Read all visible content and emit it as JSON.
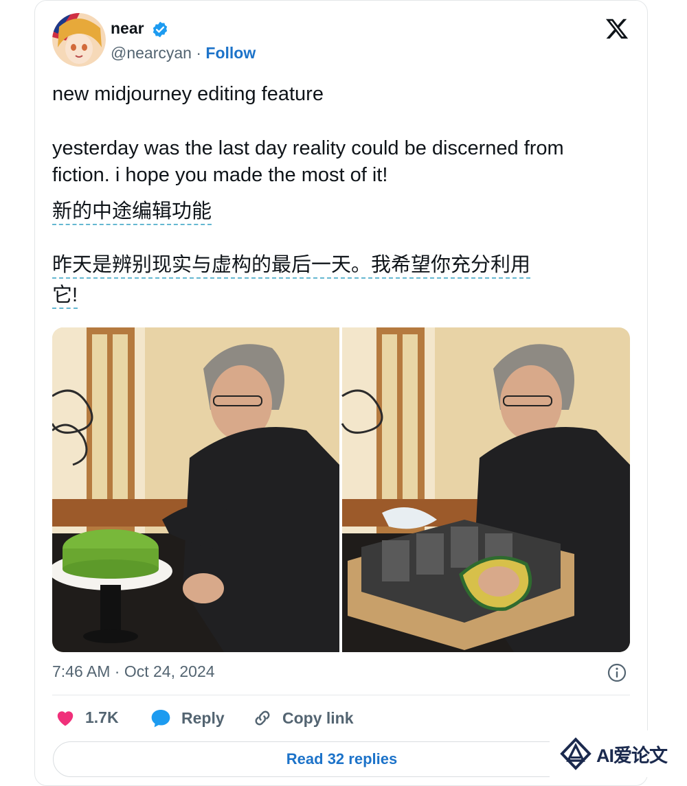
{
  "tweet": {
    "name": "near",
    "handle": "@nearcyan",
    "separator": "·",
    "follow_label": "Follow",
    "text_line1": "new midjourney editing feature",
    "text_line2": "yesterday was the last day reality could be discerned from",
    "text_line3": "fiction. i hope you made the most of it!",
    "translation_line1": "新的中途编辑功能",
    "translation_line2": "昨天是辨别现实与虚构的最后一天。我希望你充分利用",
    "translation_line3": "它!",
    "timestamp": "7:46 AM · Oct 24, 2024"
  },
  "actions": {
    "likes": "1.7K",
    "reply_label": "Reply",
    "copy_link_label": "Copy link",
    "read_replies_label": "Read 32 replies"
  },
  "watermark": {
    "text": "AI爱论文"
  },
  "icons": [
    "x-logo-icon",
    "verified-badge-icon",
    "info-icon",
    "heart-icon",
    "reply-icon",
    "link-icon"
  ],
  "colors": {
    "accent": "#1d73c9",
    "heart": "#f0307a",
    "reply": "#1d9bf0",
    "verified": "#1d9bf0"
  }
}
